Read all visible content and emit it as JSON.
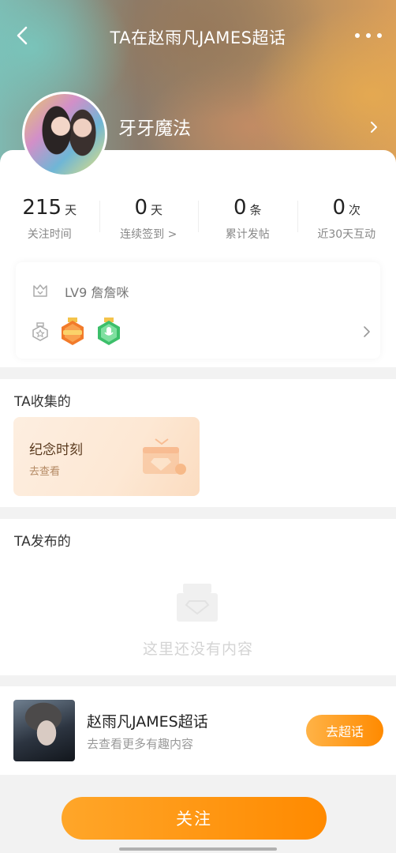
{
  "nav": {
    "title": "TA在赵雨凡JAMES超话"
  },
  "user": {
    "name": "牙牙魔法"
  },
  "stats": [
    {
      "value": "215",
      "unit": "天",
      "label": "关注时间"
    },
    {
      "value": "0",
      "unit": "天",
      "label": "连续签到 >"
    },
    {
      "value": "0",
      "unit": "条",
      "label": "累计发帖"
    },
    {
      "value": "0",
      "unit": "次",
      "label": "近30天互动"
    }
  ],
  "level": {
    "text": "LV9 詹詹咪",
    "badge_icons": [
      "lv-medal-orange-icon",
      "mic-medal-green-icon"
    ]
  },
  "collect": {
    "title": "TA收集的",
    "card_title": "纪念时刻",
    "card_sub": "去查看"
  },
  "posts": {
    "title": "TA发布的",
    "empty_text": "这里还没有内容"
  },
  "topic": {
    "name": "赵雨凡JAMES超话",
    "sub": "去查看更多有趣内容",
    "button": "去超话"
  },
  "follow_button": "关注",
  "colors": {
    "accent": "#ff8a00",
    "accent_light": "#ffb347",
    "page_bg": "#f2f2f2"
  }
}
